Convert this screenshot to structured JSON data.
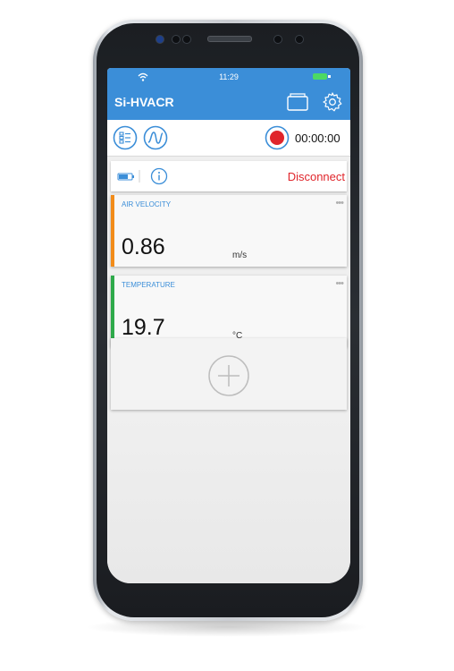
{
  "status_bar": {
    "time": "11:29"
  },
  "app_bar": {
    "title": "Si-HVACR"
  },
  "toolbar": {
    "timer": "00:00:00"
  },
  "device_bar": {
    "disconnect_label": "Disconnect"
  },
  "cards": [
    {
      "label": "AIR VELOCITY",
      "value": "0.86",
      "unit": "m/s",
      "accent_color": "#f28c1a"
    },
    {
      "label": "TEMPERATURE",
      "value": "19.7",
      "unit": "°C",
      "accent_color": "#2eaa4a"
    }
  ],
  "icons": {
    "status": [
      "wifi-icon",
      "battery-icon"
    ],
    "app_bar": [
      "folder-icon",
      "gear-icon"
    ],
    "toolbar": [
      "list-view-icon",
      "waveform-icon",
      "record-icon"
    ],
    "device_bar": [
      "device-battery-icon",
      "info-icon"
    ],
    "cards": [
      "more-icon"
    ],
    "add_card": [
      "add-icon"
    ]
  },
  "colors": {
    "primary": "#3b8ed8",
    "record": "#e0252b",
    "disconnect": "#e0252b"
  }
}
